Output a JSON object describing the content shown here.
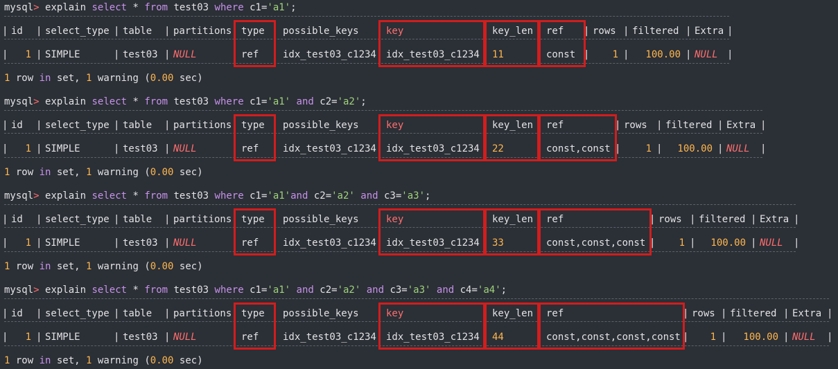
{
  "prompt": "mysql",
  "prompt_gt": ">",
  "headers": [
    "id",
    "select_type",
    "table",
    "partitions",
    "type",
    "possible_keys",
    "key",
    "key_len",
    "ref",
    "rows",
    "filtered",
    "Extra"
  ],
  "queries": [
    {
      "cmd_parts": [
        [
          "explain",
          "p"
        ],
        [
          " select",
          "k"
        ],
        [
          " * ",
          "p"
        ],
        [
          "from",
          "k"
        ],
        [
          " test03 ",
          "p"
        ],
        [
          "where",
          "k"
        ],
        [
          " c1=",
          "p"
        ],
        [
          "'a1'",
          "s"
        ],
        [
          ";",
          "p"
        ]
      ],
      "row": {
        "id": "1",
        "select_type": "SIMPLE",
        "table": "test03",
        "partitions": "NULL",
        "type": "ref",
        "possible_keys": "idx_test03_c1234",
        "key": "idx_test03_c1234",
        "key_len": "11",
        "ref": "const",
        "rows": "1",
        "filtered": "100.00",
        "Extra": "NULL"
      },
      "footer": [
        [
          "1",
          "n"
        ],
        [
          " row ",
          "p"
        ],
        [
          "in",
          "k"
        ],
        [
          " set, ",
          "p"
        ],
        [
          "1",
          "n"
        ],
        [
          " warning (",
          "p"
        ],
        [
          "0.00",
          "n"
        ],
        [
          " sec)",
          "p"
        ]
      ]
    },
    {
      "cmd_parts": [
        [
          "explain",
          "p"
        ],
        [
          " select",
          "k"
        ],
        [
          " * ",
          "p"
        ],
        [
          "from",
          "k"
        ],
        [
          " test03 ",
          "p"
        ],
        [
          "where",
          "k"
        ],
        [
          " c1=",
          "p"
        ],
        [
          "'a1'",
          "s"
        ],
        [
          " ",
          "p"
        ],
        [
          "and",
          "k"
        ],
        [
          " c2=",
          "p"
        ],
        [
          "'a2'",
          "s"
        ],
        [
          ";",
          "p"
        ]
      ],
      "row": {
        "id": "1",
        "select_type": "SIMPLE",
        "table": "test03",
        "partitions": "NULL",
        "type": "ref",
        "possible_keys": "idx_test03_c1234",
        "key": "idx_test03_c1234",
        "key_len": "22",
        "ref": "const,const",
        "rows": "1",
        "filtered": "100.00",
        "Extra": "NULL"
      },
      "footer": [
        [
          "1",
          "n"
        ],
        [
          " row ",
          "p"
        ],
        [
          "in",
          "k"
        ],
        [
          " set, ",
          "p"
        ],
        [
          "1",
          "n"
        ],
        [
          " warning (",
          "p"
        ],
        [
          "0.00",
          "n"
        ],
        [
          " sec)",
          "p"
        ]
      ]
    },
    {
      "cmd_parts": [
        [
          "explain",
          "p"
        ],
        [
          " select",
          "k"
        ],
        [
          " * ",
          "p"
        ],
        [
          "from",
          "k"
        ],
        [
          " test03 ",
          "p"
        ],
        [
          "where",
          "k"
        ],
        [
          " c1=",
          "p"
        ],
        [
          "'a1'",
          "s"
        ],
        [
          "and",
          "k"
        ],
        [
          " c2=",
          "p"
        ],
        [
          "'a2'",
          "s"
        ],
        [
          " ",
          "p"
        ],
        [
          "and",
          "k"
        ],
        [
          " c3=",
          "p"
        ],
        [
          "'a3'",
          "s"
        ],
        [
          ";",
          "p"
        ]
      ],
      "row": {
        "id": "1",
        "select_type": "SIMPLE",
        "table": "test03",
        "partitions": "NULL",
        "type": "ref",
        "possible_keys": "idx_test03_c1234",
        "key": "idx_test03_c1234",
        "key_len": "33",
        "ref": "const,const,const",
        "rows": "1",
        "filtered": "100.00",
        "Extra": "NULL"
      },
      "footer": [
        [
          "1",
          "n"
        ],
        [
          " row ",
          "p"
        ],
        [
          "in",
          "k"
        ],
        [
          " set, ",
          "p"
        ],
        [
          "1",
          "n"
        ],
        [
          " warning (",
          "p"
        ],
        [
          "0.00",
          "n"
        ],
        [
          " sec)",
          "p"
        ]
      ]
    },
    {
      "cmd_parts": [
        [
          "explain",
          "p"
        ],
        [
          " select",
          "k"
        ],
        [
          " * ",
          "p"
        ],
        [
          "from",
          "k"
        ],
        [
          " test03 ",
          "p"
        ],
        [
          "where",
          "k"
        ],
        [
          " c1=",
          "p"
        ],
        [
          "'a1'",
          "s"
        ],
        [
          " ",
          "p"
        ],
        [
          "and",
          "k"
        ],
        [
          " c2=",
          "p"
        ],
        [
          "'a2'",
          "s"
        ],
        [
          " ",
          "p"
        ],
        [
          "and",
          "k"
        ],
        [
          " c3=",
          "p"
        ],
        [
          "'a3'",
          "s"
        ],
        [
          " ",
          "p"
        ],
        [
          "and",
          "k"
        ],
        [
          " c4=",
          "p"
        ],
        [
          "'a4'",
          "s"
        ],
        [
          ";",
          "p"
        ]
      ],
      "row": {
        "id": "1",
        "select_type": "SIMPLE",
        "table": "test03",
        "partitions": "NULL",
        "type": "ref",
        "possible_keys": "idx_test03_c1234",
        "key": "idx_test03_c1234",
        "key_len": "44",
        "ref": "const,const,const,const",
        "rows": "1",
        "filtered": "100.00",
        "Extra": "NULL"
      },
      "footer": [
        [
          "1",
          "n"
        ],
        [
          " row ",
          "p"
        ],
        [
          "in",
          "k"
        ],
        [
          " set, ",
          "p"
        ],
        [
          "1",
          "n"
        ],
        [
          " warning (",
          "p"
        ],
        [
          "0.00",
          "n"
        ],
        [
          " sec)",
          "p"
        ]
      ]
    }
  ]
}
